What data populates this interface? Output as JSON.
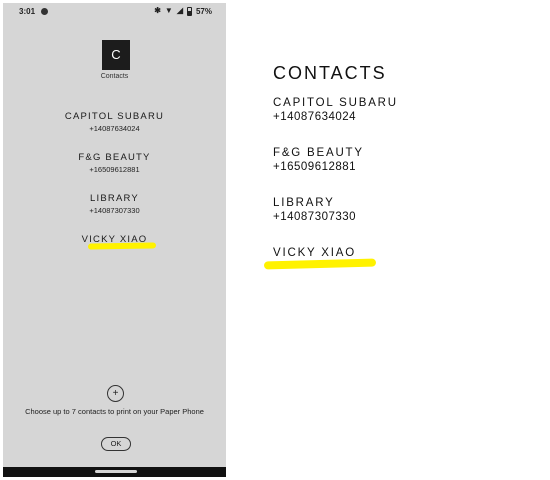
{
  "phone": {
    "status": {
      "time": "3:01",
      "battery": "57%",
      "icons": [
        "app-notification-icon",
        "bluetooth-icon",
        "wifi-icon",
        "signal-icon",
        "battery-icon"
      ]
    },
    "app": {
      "logo_letter": "C",
      "name": "Contacts"
    },
    "contacts": [
      {
        "name": "CAPITOL SUBARU",
        "phone": "+14087634024"
      },
      {
        "name": "F&G BEAUTY",
        "phone": "+16509612881"
      },
      {
        "name": "LIBRARY",
        "phone": "+14087307330"
      },
      {
        "name": "VICKY XIAO",
        "phone": ""
      }
    ],
    "add_button": "+",
    "hint": "Choose up to 7 contacts to print on your Paper Phone",
    "ok_button": "OK"
  },
  "paper": {
    "title": "CONTACTS",
    "contacts": [
      {
        "name": "CAPITOL SUBARU",
        "phone": "+14087634024"
      },
      {
        "name": "F&G BEAUTY",
        "phone": "+16509612881"
      },
      {
        "name": "LIBRARY",
        "phone": "+14087307330"
      },
      {
        "name": "VICKY XIAO",
        "phone": ""
      }
    ]
  },
  "colors": {
    "phone_bg": "#d6d6d6",
    "highlight": "#fff200",
    "paper_bg": "#ffffff"
  }
}
